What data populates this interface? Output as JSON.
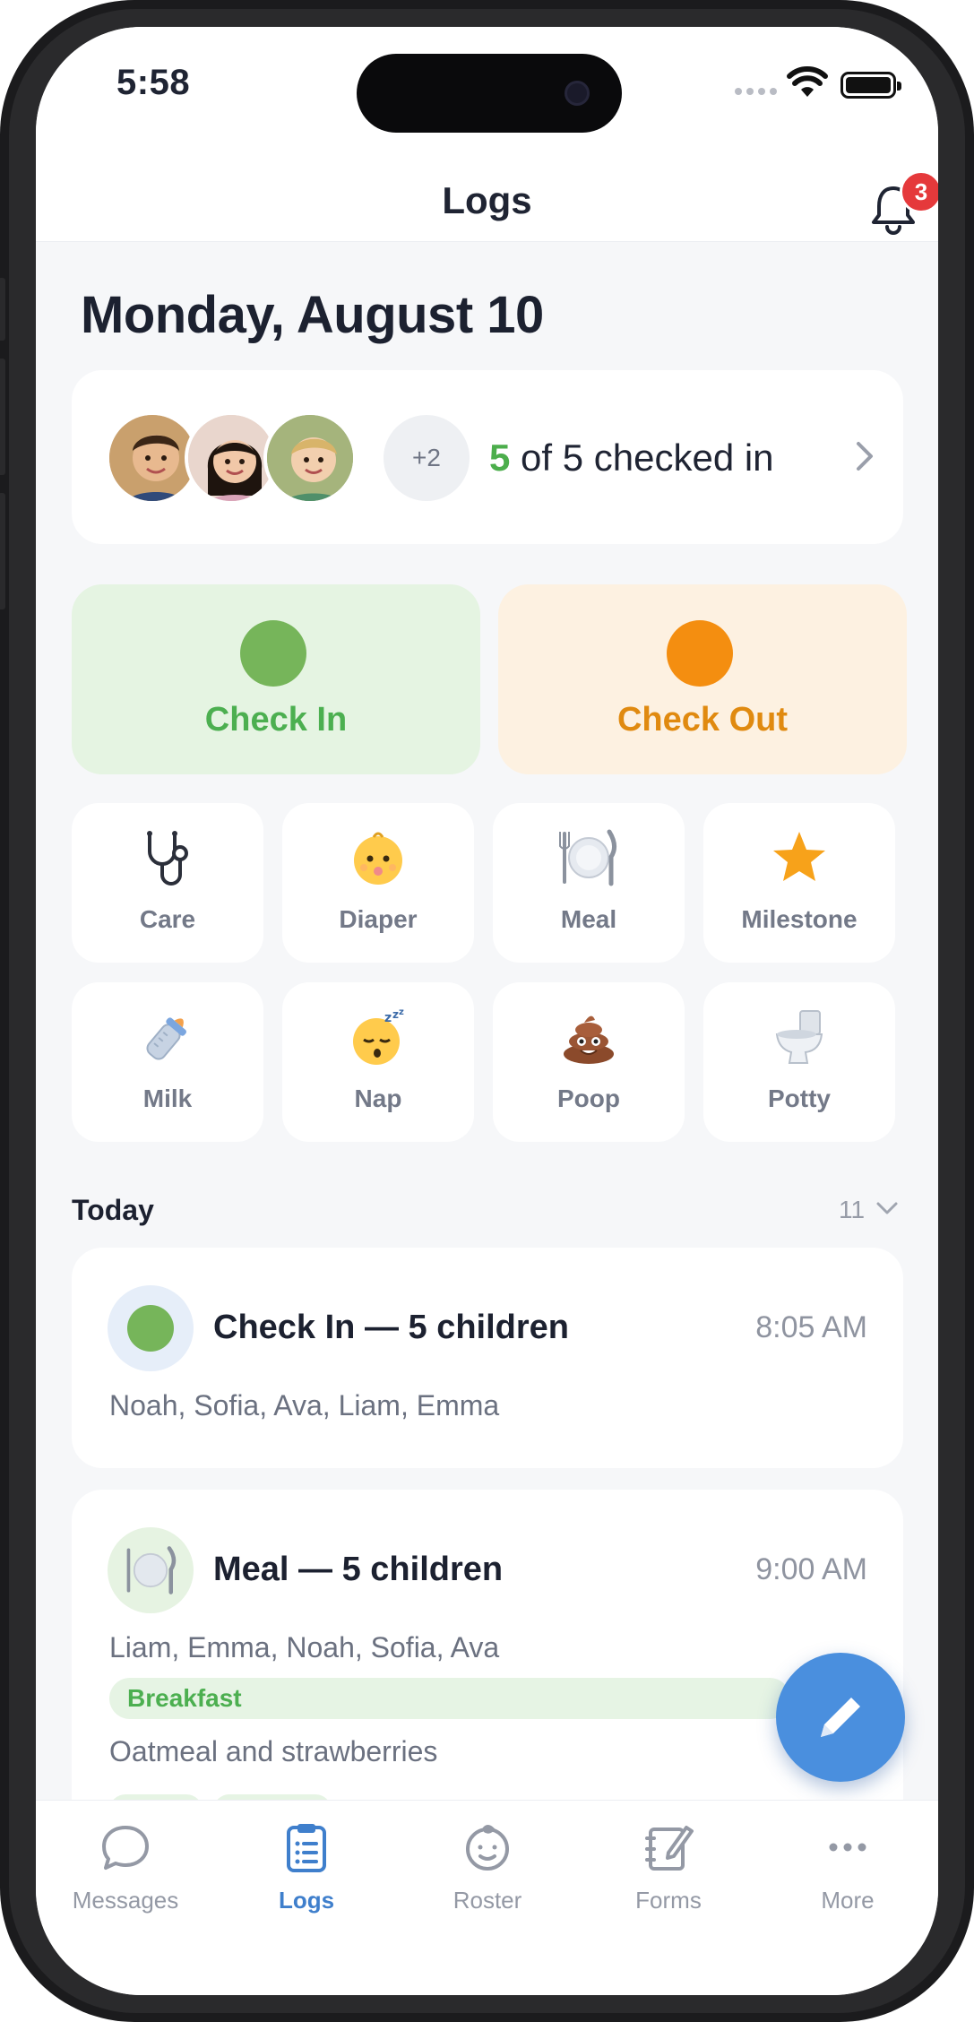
{
  "status_bar": {
    "time": "5:58"
  },
  "header": {
    "title": "Logs",
    "notification_count": "3"
  },
  "date_heading": "Monday, August 10",
  "checked_in_summary": {
    "extra_avatars": "+2",
    "checked_count": "5",
    "rest": " of 5 checked in"
  },
  "actions": {
    "check_in": "Check In",
    "check_out": "Check Out"
  },
  "log_types": [
    {
      "label": "Care",
      "icon": "stethoscope-icon"
    },
    {
      "label": "Diaper",
      "icon": "baby-icon"
    },
    {
      "label": "Meal",
      "icon": "plate-cutlery-icon"
    },
    {
      "label": "Milestone",
      "icon": "star-icon"
    },
    {
      "label": "Milk",
      "icon": "baby-bottle-icon"
    },
    {
      "label": "Nap",
      "icon": "sleeping-face-icon"
    },
    {
      "label": "Poop",
      "icon": "poop-icon"
    },
    {
      "label": "Potty",
      "icon": "toilet-icon"
    }
  ],
  "today": {
    "title": "Today",
    "count": "11"
  },
  "logs": [
    {
      "title": "Check In — 5 children",
      "time": "8:05 AM",
      "names": "Noah, Sofia, Ava, Liam, Emma"
    },
    {
      "title": "Meal — 5 children",
      "time": "9:00 AM",
      "names": "Liam, Emma, Noah, Sofia, Ava",
      "tag": "Breakfast",
      "note": "Oatmeal and strawberries"
    }
  ],
  "tabs": [
    {
      "label": "Messages",
      "active": false
    },
    {
      "label": "Logs",
      "active": true
    },
    {
      "label": "Roster",
      "active": false
    },
    {
      "label": "Forms",
      "active": false
    },
    {
      "label": "More",
      "active": false
    }
  ],
  "colors": {
    "green": "#4caf50",
    "orange": "#f48e10",
    "blue": "#4a8fde",
    "badge_red": "#e5393b"
  }
}
